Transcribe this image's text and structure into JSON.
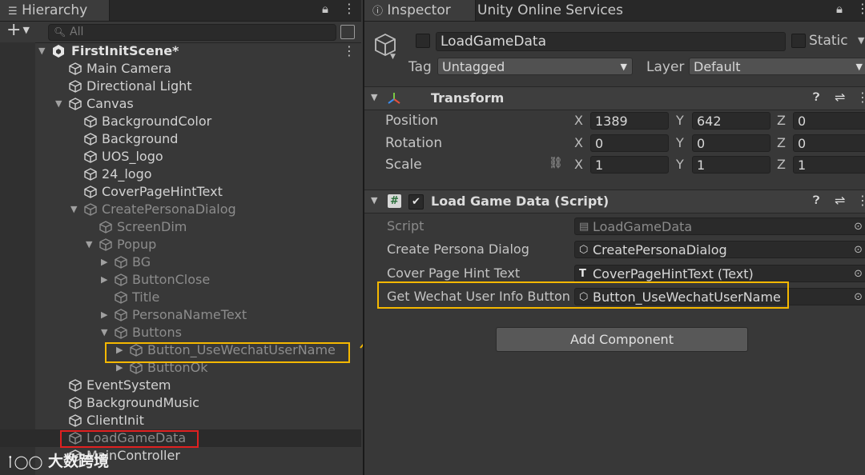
{
  "hierarchy": {
    "tab_label": "Hierarchy",
    "search_placeholder": "All",
    "add_label": "+",
    "scene_name": "FirstInitScene*",
    "items": [
      {
        "label": "Main Camera"
      },
      {
        "label": "Directional Light"
      },
      {
        "label": "Canvas"
      },
      {
        "label": "BackgroundColor"
      },
      {
        "label": "Background"
      },
      {
        "label": "UOS_logo"
      },
      {
        "label": "24_logo"
      },
      {
        "label": "CoverPageHintText"
      },
      {
        "label": "CreatePersonaDialog"
      },
      {
        "label": "ScreenDim"
      },
      {
        "label": "Popup"
      },
      {
        "label": "BG"
      },
      {
        "label": "ButtonClose"
      },
      {
        "label": "Title"
      },
      {
        "label": "PersonaNameText"
      },
      {
        "label": "Buttons"
      },
      {
        "label": "Button_UseWechatUserName"
      },
      {
        "label": "ButtonOk"
      },
      {
        "label": "EventSystem"
      },
      {
        "label": "BackgroundMusic"
      },
      {
        "label": "ClientInit"
      },
      {
        "label": "LoadGameData"
      },
      {
        "label": "MainController"
      }
    ]
  },
  "inspector": {
    "tab_label": "Inspector",
    "tab2_label": "Unity Online Services",
    "object_name": "LoadGameData",
    "static_label": "Static",
    "tag_label": "Tag",
    "tag_value": "Untagged",
    "layer_label": "Layer",
    "layer_value": "Default",
    "transform": {
      "title": "Transform",
      "rows": [
        {
          "label": "Position",
          "x": "1389",
          "y": "642",
          "z": "0"
        },
        {
          "label": "Rotation",
          "x": "0",
          "y": "0",
          "z": "0"
        },
        {
          "label": "Scale",
          "x": "1",
          "y": "1",
          "z": "1"
        }
      ],
      "axis_x": "X",
      "axis_y": "Y",
      "axis_z": "Z"
    },
    "script_component": {
      "title": "Load Game Data (Script)",
      "fields": [
        {
          "label": "Script",
          "value": "LoadGameData"
        },
        {
          "label": "Create Persona Dialog",
          "value": "CreatePersonaDialog"
        },
        {
          "label": "Cover Page Hint Text",
          "value": "CoverPageHintText (Text)"
        },
        {
          "label": "Get Wechat User Info Button",
          "value": "Button_UseWechatUserName"
        }
      ]
    },
    "add_component_label": "Add Component"
  },
  "watermark": "大数跨境",
  "colors": {
    "highlight_yellow": "#f5b800",
    "highlight_red": "#e02020",
    "panel_bg": "#383838"
  }
}
